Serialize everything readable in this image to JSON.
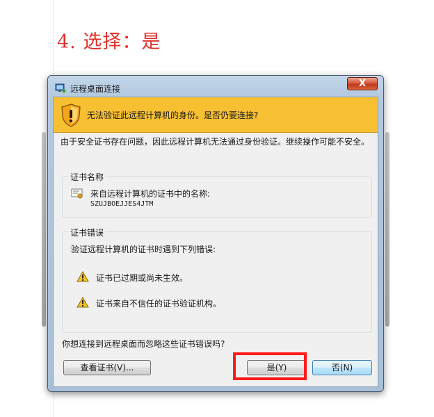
{
  "instruction": {
    "step_text": "4. 选择：是"
  },
  "dialog": {
    "title": "远程桌面连接",
    "close_label": "X",
    "banner_text": "无法验证此远程计算机的身份。是否仍要连接?",
    "message": "由于安全证书存在问题，因此远程计算机无法通过身份验证。继续操作可能不安全。",
    "cert_name_group": {
      "label": "证书名称",
      "line1": "来自远程计算机的证书中的名称:",
      "line2": "SZUJBOEJJES4JTM"
    },
    "cert_errors_group": {
      "label": "证书错误",
      "intro": "验证远程计算机的证书时遇到下列错误:",
      "items": [
        "证书已过期或尚未生效。",
        "证书来自不信任的证书验证机构。"
      ]
    },
    "question": "你想连接到远程桌面而忽略这些证书错误吗?",
    "buttons": {
      "view_cert": "查看证书(V)...",
      "yes": "是(Y)",
      "no": "否(N)"
    }
  },
  "colors": {
    "banner": "#f7bf32",
    "highlight": "#ff1a1a",
    "step_text": "#e0312a"
  },
  "icons": [
    "remote-desktop-icon",
    "shield-warning-icon",
    "certificate-icon",
    "warning-triangle-icon"
  ]
}
